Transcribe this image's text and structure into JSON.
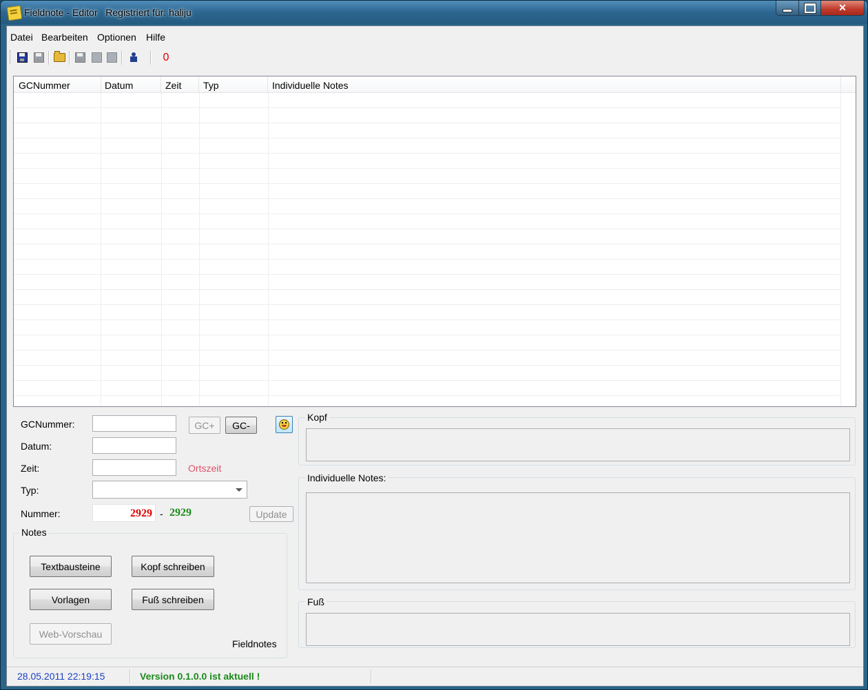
{
  "window": {
    "title": "Fieldnote - Editor   Registriert für: haliju",
    "colors": {
      "title_bar": "#2b6690",
      "close_button": "#c0392b"
    }
  },
  "menu": [
    "Datei",
    "Bearbeiten",
    "Optionen",
    "Hilfe"
  ],
  "toolbar": {
    "icons": [
      "save-icon",
      "save-all-icon",
      "open-folder-icon",
      "save-disabled-icon",
      "export-disabled-icon",
      "import-disabled-icon",
      "user-icon"
    ],
    "counter": "0",
    "counter_color": "#e00000"
  },
  "grid": {
    "columns": [
      "GCNummer",
      "Datum",
      "Zeit",
      "Typ",
      "Individuelle Notes"
    ],
    "rows": []
  },
  "form": {
    "gcnummer_label": "GCNummer:",
    "gcnummer_value": "",
    "datum_label": "Datum:",
    "datum_value": "",
    "zeit_label": "Zeit:",
    "zeit_value": "",
    "ortszeit": "Ortszeit",
    "typ_label": "Typ:",
    "typ_value": "",
    "nummer_label": "Nummer:",
    "nummer_from": "2929",
    "nummer_dash": "-",
    "nummer_to": "2929",
    "gc_plus": "GC+",
    "gc_minus": "GC-",
    "update": "Update",
    "smiley_icon": "smiley-icon"
  },
  "notes_group": {
    "title": "Notes",
    "textbausteine": "Textbausteine",
    "kopf_schreiben": "Kopf schreiben",
    "vorlagen": "Vorlagen",
    "fuss_schreiben": "Fuß schreiben",
    "web_vorschau": "Web-Vorschau",
    "fieldnotes_label": "Fieldnotes"
  },
  "right_panels": {
    "kopf": "Kopf",
    "individuelle": "Individuelle Notes:",
    "fuss": "Fuß"
  },
  "status": {
    "datetime": "28.05.2011 22:19:15",
    "datetime_color": "#1a3fc4",
    "version": "Version 0.1.0.0 ist aktuell !",
    "version_color": "#1a8a1a"
  }
}
